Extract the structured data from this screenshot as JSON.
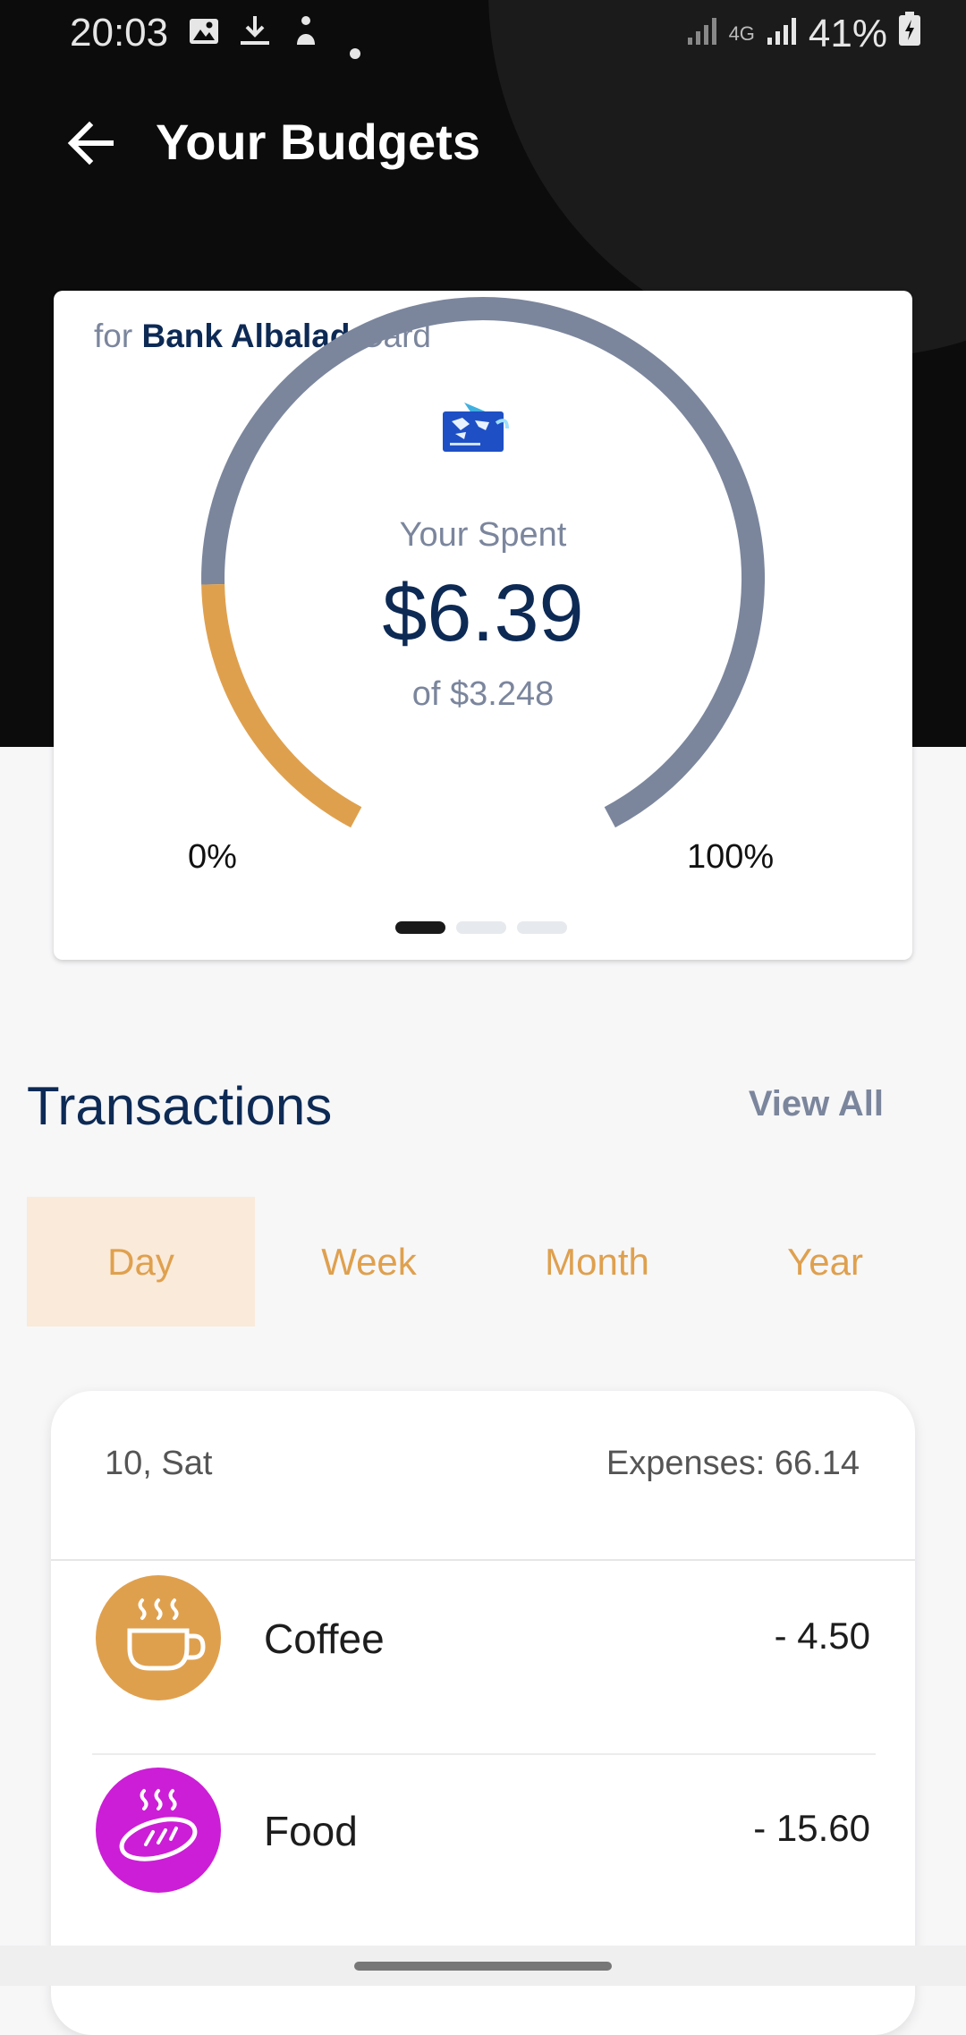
{
  "status_bar": {
    "time": "20:03",
    "network": "4G",
    "battery": "41%",
    "icons": [
      "image-icon",
      "download-icon",
      "notification-icon",
      "dot-icon",
      "signal-icon",
      "signal-icon",
      "battery-charging-icon"
    ]
  },
  "header": {
    "back_icon": "arrow-left-icon",
    "title": "Your Budgets"
  },
  "budget_card": {
    "caption_prefix": "for",
    "bank_name": "Bank Albalad",
    "caption_suffix": "Card",
    "card_icon": "credit-card-icon",
    "spent_label": "Your Spent",
    "spent_amount": "$6.39",
    "budget_text": "of $3.248",
    "min_label": "0%",
    "max_label": "100%",
    "progress_fraction": 0.2,
    "pager": {
      "count": 3,
      "active_index": 0
    },
    "colors": {
      "spent": "#dfa04e",
      "remaining": "#7b869d"
    }
  },
  "transactions": {
    "title": "Transactions",
    "view_all": "View All",
    "tabs": [
      {
        "label": "Day",
        "selected": true
      },
      {
        "label": "Week",
        "selected": false
      },
      {
        "label": "Month",
        "selected": false
      },
      {
        "label": "Year",
        "selected": false
      }
    ],
    "day_group": {
      "date": "10, Sat",
      "expenses": "Expenses: 66.14",
      "items": [
        {
          "name": "Coffee",
          "amount": "- 4.50",
          "icon": "coffee-cup-icon",
          "color": "#dfa04e"
        },
        {
          "name": "Food",
          "amount": "- 15.60",
          "icon": "bread-icon",
          "color": "#cc1ed6"
        }
      ]
    }
  },
  "theme": {
    "accent": "#dfa04e",
    "navy": "#0d2a55",
    "muted": "#7b869d"
  }
}
